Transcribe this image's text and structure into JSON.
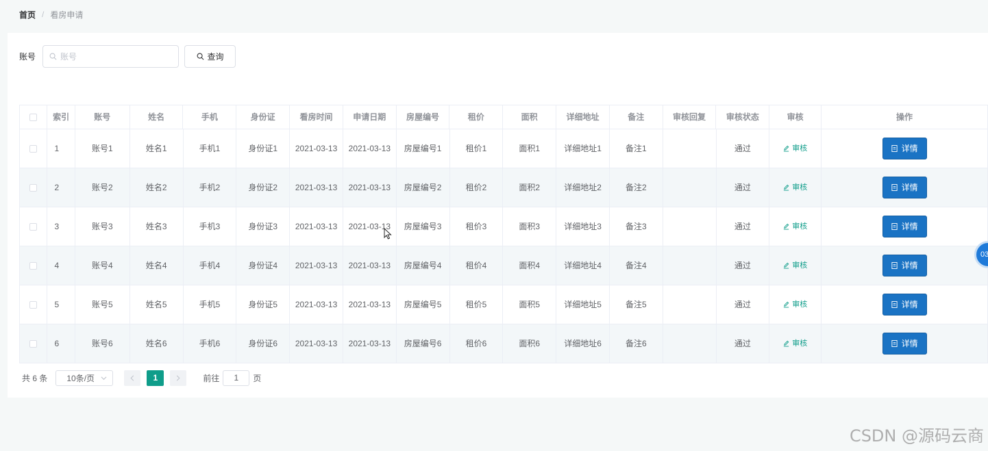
{
  "breadcrumb": {
    "home": "首页",
    "separator": "/",
    "current": "看房申请"
  },
  "search": {
    "label": "账号",
    "placeholder": "账号",
    "value": "",
    "button_label": "查询"
  },
  "table": {
    "headers": {
      "index": "索引",
      "account": "账号",
      "name": "姓名",
      "phone": "手机",
      "id_card": "身份证",
      "view_time": "看房时间",
      "apply_date": "申请日期",
      "house_no": "房屋编号",
      "rent": "租价",
      "area": "面积",
      "address": "详细地址",
      "remark": "备注",
      "reply": "审核回复",
      "status": "审核状态",
      "audit": "审核",
      "action": "操作"
    },
    "audit_label": "审核",
    "detail_label": "详情",
    "rows": [
      {
        "index": "1",
        "account": "账号1",
        "name": "姓名1",
        "phone": "手机1",
        "id_card": "身份证1",
        "view_time": "2021-03-13",
        "apply_date": "2021-03-13",
        "house_no": "房屋编号1",
        "rent": "租价1",
        "area": "面积1",
        "address": "详细地址1",
        "remark": "备注1",
        "reply": "",
        "status": "通过"
      },
      {
        "index": "2",
        "account": "账号2",
        "name": "姓名2",
        "phone": "手机2",
        "id_card": "身份证2",
        "view_time": "2021-03-13",
        "apply_date": "2021-03-13",
        "house_no": "房屋编号2",
        "rent": "租价2",
        "area": "面积2",
        "address": "详细地址2",
        "remark": "备注2",
        "reply": "",
        "status": "通过"
      },
      {
        "index": "3",
        "account": "账号3",
        "name": "姓名3",
        "phone": "手机3",
        "id_card": "身份证3",
        "view_time": "2021-03-13",
        "apply_date": "2021-03-13",
        "house_no": "房屋编号3",
        "rent": "租价3",
        "area": "面积3",
        "address": "详细地址3",
        "remark": "备注3",
        "reply": "",
        "status": "通过"
      },
      {
        "index": "4",
        "account": "账号4",
        "name": "姓名4",
        "phone": "手机4",
        "id_card": "身份证4",
        "view_time": "2021-03-13",
        "apply_date": "2021-03-13",
        "house_no": "房屋编号4",
        "rent": "租价4",
        "area": "面积4",
        "address": "详细地址4",
        "remark": "备注4",
        "reply": "",
        "status": "通过"
      },
      {
        "index": "5",
        "account": "账号5",
        "name": "姓名5",
        "phone": "手机5",
        "id_card": "身份证5",
        "view_time": "2021-03-13",
        "apply_date": "2021-03-13",
        "house_no": "房屋编号5",
        "rent": "租价5",
        "area": "面积5",
        "address": "详细地址5",
        "remark": "备注5",
        "reply": "",
        "status": "通过"
      },
      {
        "index": "6",
        "account": "账号6",
        "name": "姓名6",
        "phone": "手机6",
        "id_card": "身份证6",
        "view_time": "2021-03-13",
        "apply_date": "2021-03-13",
        "house_no": "房屋编号6",
        "rent": "租价6",
        "area": "面积6",
        "address": "详细地址6",
        "remark": "备注6",
        "reply": "",
        "status": "通过"
      }
    ]
  },
  "pagination": {
    "total": "共 6 条",
    "page_size": "10条/页",
    "current_page": "1",
    "goto_prefix": "前往",
    "goto_value": "1",
    "goto_suffix": "页"
  },
  "float_timer": "03:",
  "watermark": "CSDN @源码云商",
  "colors": {
    "accent": "#0f9d8a",
    "primary_button": "#1a73c4",
    "stripe": "#f3f7f9"
  }
}
